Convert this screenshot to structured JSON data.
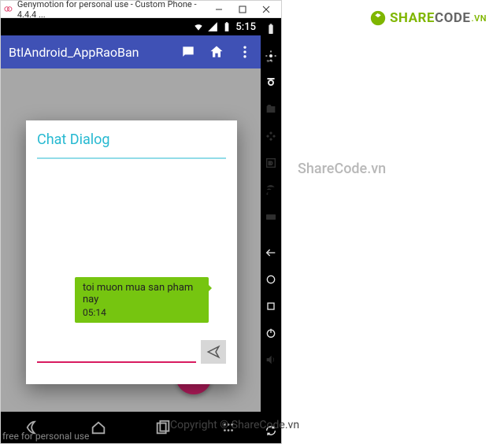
{
  "window": {
    "title": "Genymotion for personal use - Custom Phone - 4.4.4 ..."
  },
  "status": {
    "time": "5:15"
  },
  "appbar": {
    "title": "BtlAndroid_AppRaoBan"
  },
  "dialog": {
    "title": "Chat Dialog",
    "message": "toi muon mua san pham nay",
    "msg_time": "05:14",
    "input_placeholder": ""
  },
  "footer": {
    "free_text": "free for personal use"
  },
  "branding": {
    "logo_green": "SHARE",
    "logo_gray": "CODE",
    "logo_domain": ".VN",
    "watermark": "ShareCode.vn",
    "copyright": "Copyright © ShareCode.vn"
  }
}
